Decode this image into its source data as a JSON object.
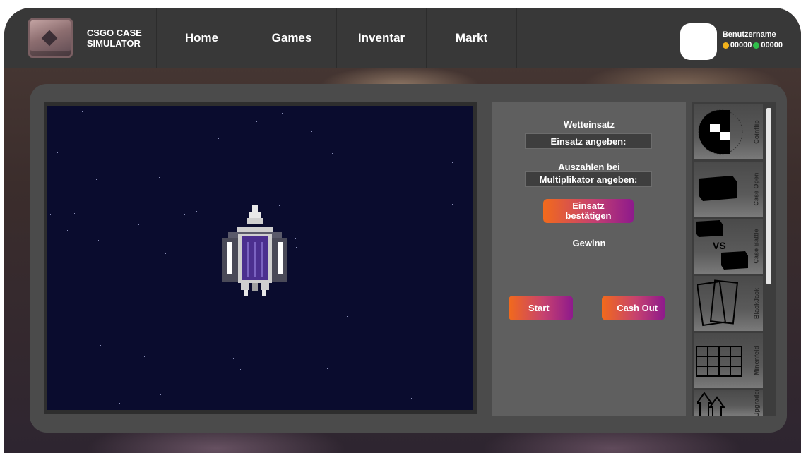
{
  "brand": {
    "name": "CSGO CASE\nSIMULATOR"
  },
  "nav": {
    "home": "Home",
    "games": "Games",
    "inventory": "Inventar",
    "market": "Markt"
  },
  "user": {
    "name": "Benutzername",
    "coins": "00000",
    "gems": "00000"
  },
  "controls": {
    "bet_title": "Wetteinsatz",
    "bet_placeholder": "Einsatz angeben:",
    "cashout_title": "Auszahlen bei",
    "multiplier_placeholder": "Multiplikator angeben:",
    "confirm_label": "Einsatz\nbestätigen",
    "win_label": "Gewinn",
    "start_label": "Start",
    "cashout_label": "Cash Out"
  },
  "games": [
    {
      "label": "Coinflip",
      "icon": "coin-icon"
    },
    {
      "label": "Case Open",
      "icon": "case-icon"
    },
    {
      "label": "Case Battle",
      "icon": "versus-icon",
      "vs_text": "VS"
    },
    {
      "label": "BlackJack",
      "icon": "cards-icon"
    },
    {
      "label": "Minenfeld",
      "icon": "grid-icon"
    },
    {
      "label": "Upgrader",
      "icon": "arrows-icon"
    }
  ],
  "colors": {
    "nav_bg": "#383838",
    "panel_bg": "#4b4b4b",
    "game_bg": "#0a0c2e",
    "accent_start": "#f26a1b",
    "accent_end": "#8e1a8c"
  }
}
